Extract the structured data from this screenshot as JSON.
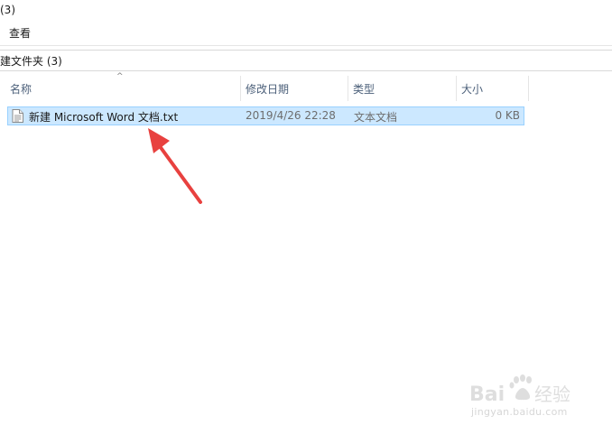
{
  "window": {
    "title": "(3)"
  },
  "ribbon": {
    "tabs": [
      {
        "label": "查看"
      }
    ]
  },
  "address": {
    "path": "建文件夹 (3)"
  },
  "columns": [
    {
      "label": "名称",
      "sorted": true
    },
    {
      "label": "修改日期"
    },
    {
      "label": "类型"
    },
    {
      "label": "大小"
    }
  ],
  "files": [
    {
      "name": "新建 Microsoft Word 文档.txt",
      "modified": "2019/4/26 22:28",
      "type": "文本文档",
      "size": "0 KB",
      "icon": "text-file-icon",
      "selected": true
    }
  ],
  "annotation": {
    "color": "#e8413f",
    "icon": "red-arrow-icon"
  },
  "watermark": {
    "brand": "Baidu经验",
    "url": "jingyan.baidu.com"
  },
  "colors": {
    "selection_bg": "#cce8ff",
    "selection_border": "#99d1ff",
    "header_text": "#4c607a"
  }
}
